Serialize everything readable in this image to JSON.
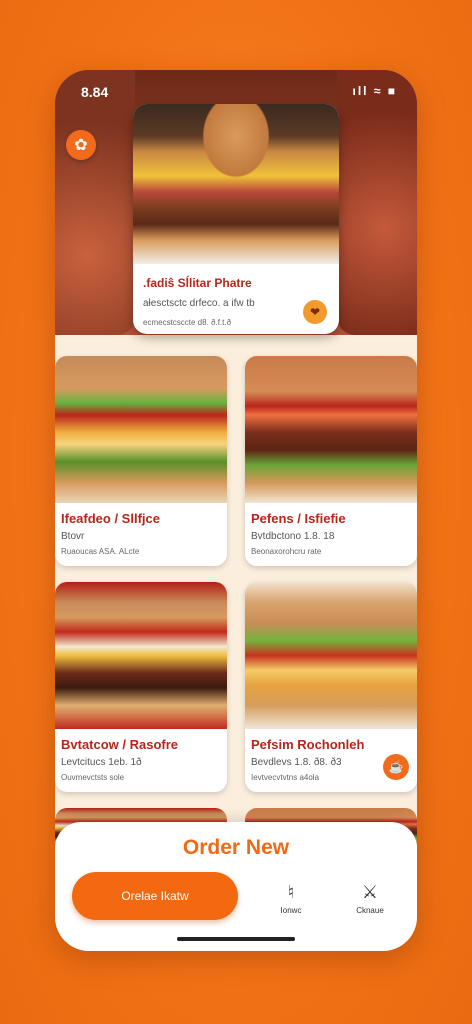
{
  "status": {
    "time": "8.84",
    "icons": "ıll ≈ ■"
  },
  "header": {
    "logo_icon": "burger-logo-icon"
  },
  "featured": {
    "title": ".fadiŝ Sĺlitar Phatre",
    "subtitle": "ałesctsctc drfeco. a ifw tb",
    "meta": "ecmecstcsccte d8. ð.f.t.ð",
    "fav_icon": "heart-icon"
  },
  "items": [
    {
      "title": "Ifeafdeo / Sllfjce",
      "subtitle": "Btovr",
      "meta": "Ruaoucas ASA. ALcte"
    },
    {
      "title": "Pefens / Isfiefie",
      "subtitle": "Bvtdbctono 1.8. 18",
      "meta": "Beonaxorohcru rate"
    },
    {
      "title": "Bvtatcow / Rasofre",
      "subtitle": "Levtcitucs 1eb. 1ð",
      "meta": "Ouvmevctsts sole"
    },
    {
      "title": "Pefsim Rochonleh",
      "subtitle": "Bevdlevs 1.8. ð8. ð3",
      "meta": "Ievtvecvtvtns a4ola"
    }
  ],
  "order_panel": {
    "title": "Order New",
    "button_label": "Orelae Ikatw",
    "nav": [
      {
        "icon": "bell-icon",
        "label": "Ionwc"
      },
      {
        "icon": "user-icon",
        "label": "Cknaue"
      }
    ]
  },
  "colors": {
    "accent": "#f2690f",
    "title_red": "#b8251a",
    "background": "#f47a1f"
  }
}
